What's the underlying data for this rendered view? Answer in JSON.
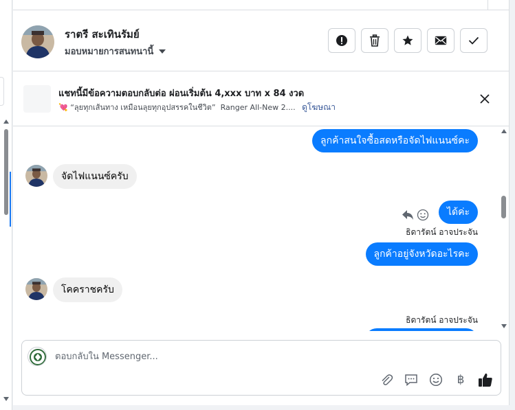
{
  "header": {
    "customer_name": "ราตรี สะเทินรัมย์",
    "assign_label": "มอบหมายการสนทนานี้",
    "actions": [
      {
        "name": "report-icon"
      },
      {
        "name": "trash-icon"
      },
      {
        "name": "star-icon"
      },
      {
        "name": "mail-icon"
      },
      {
        "name": "check-icon"
      }
    ]
  },
  "ad_banner": {
    "title": "แชทนี้มีข้อความตอบกลับต่อ ผ่อนเริ่มต้น 4,xxx บาท x 84 งวด",
    "subtitle": "“ลุยทุกเส้นทาง เหมือนลุยทุกอุปสรรคในชีวิต”  Ranger All-New 2....",
    "link": "ดูโฆษณา"
  },
  "messages": [
    {
      "direction": "out",
      "text": "ลูกค้าสนใจซื้อสดหรือจัดไฟแนนซ์คะ"
    },
    {
      "direction": "in",
      "text": "จัดไฟแนนซ์ครับ"
    },
    {
      "direction": "out",
      "text": "ได้ค่ะ"
    },
    {
      "sender": "ธิดารัตน์ อาจประจัน"
    },
    {
      "direction": "out",
      "text": "ลูกค้าอยู่จังหวัดอะไรคะ"
    },
    {
      "direction": "in",
      "text": "โคคราชครับ"
    },
    {
      "sender": "ธิดารัตน์ อาจประจัน"
    }
  ],
  "composer": {
    "placeholder": "ตอบกลับใน Messenger...",
    "tools": [
      "paperclip-icon",
      "chat-icon",
      "smiley-icon",
      "baht-icon",
      "thumbs-up-icon"
    ],
    "baht_symbol": "฿"
  },
  "colors": {
    "bubble_out": "#0a7cff",
    "bubble_in": "#f0f0f0",
    "link": "#385898"
  }
}
